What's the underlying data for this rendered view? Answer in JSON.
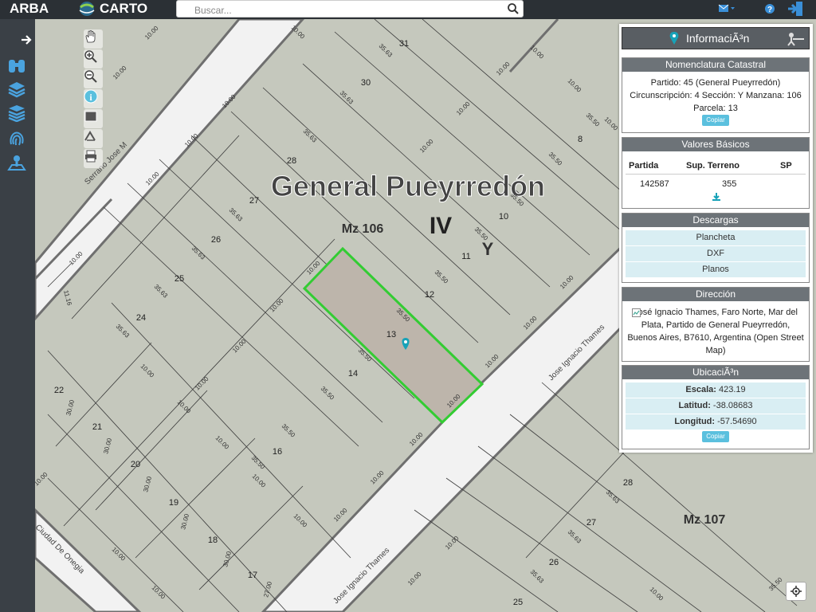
{
  "topbar": {
    "logo_arba": "ARBA",
    "logo_carto": "CARTO",
    "search_placeholder": "Buscar..."
  },
  "icons": {
    "left": [
      "arrow-right-icon",
      "binoculars-icon",
      "layers-icon",
      "layers-stack-icon",
      "fingerprint-icon",
      "map-pin-user-icon"
    ],
    "map_tools": [
      "pan-hand-icon",
      "zoom-in-icon",
      "zoom-out-icon",
      "info-icon",
      "select-box-icon",
      "measure-icon",
      "print-icon"
    ],
    "top_right": [
      "mail-icon",
      "help-icon",
      "logout-icon"
    ]
  },
  "colors": {
    "parcel_highlight": "#33cc33",
    "map_bg": "#c5c8bd",
    "street_fill": "#f2f2f2",
    "header_bg": "#2b3035",
    "panel_header": "#6d7378",
    "button_info": "#5bc0de"
  },
  "map": {
    "region_label": "General Pueyrredón",
    "circ_label": "IV",
    "section_label": "Y",
    "manzana_labels": [
      "Mz 106",
      "Mz 107"
    ],
    "selected_parcel": "13",
    "parcel_numbers": [
      "31",
      "30",
      "28",
      "27",
      "26",
      "25",
      "24",
      "22",
      "21",
      "20",
      "19",
      "18",
      "17",
      "16",
      "14",
      "13",
      "12",
      "11",
      "10",
      "8",
      "28",
      "27",
      "26",
      "25"
    ],
    "dimension_labels": [
      "10.00",
      "35.63",
      "35.50",
      "30.00",
      "11.16",
      "27.00"
    ],
    "street_labels": [
      "Serrano Jose M",
      "Jose Ignacio Thames",
      "Jose Ignacio Thames",
      "Ciudad De Onegia"
    ]
  },
  "panel": {
    "title": "InformaciÃ³n",
    "nomenclatura": {
      "header": "Nomenclatura Catastral",
      "line1": "Partido: 45 (General Pueyrredón)",
      "line2": "Circunscripción: 4 Sección: Y Manzana: 106",
      "line3": "Parcela: 13",
      "copy": "Copiar"
    },
    "valores": {
      "header": "Valores Básicos",
      "col1": "Partida",
      "col2": "Sup. Terreno",
      "col3": "SP",
      "partida": "142587",
      "sup": "355",
      "sp": ""
    },
    "descargas": {
      "header": "Descargas",
      "items": [
        "Plancheta",
        "DXF",
        "Planos"
      ]
    },
    "direccion": {
      "header": "Dirección",
      "text": "José Ignacio Thames, Faro Norte, Mar del Plata, Partido de General Pueyrredón, Buenos Aires, B7610, Argentina (Open Street Map)"
    },
    "ubicacion": {
      "header": "UbicaciÃ³n",
      "escala_label": "Escala:",
      "escala": "423.19",
      "latitud_label": "Latitud:",
      "latitud": "-38.08683",
      "longitud_label": "Longitud:",
      "longitud": "-57.54690",
      "copy": "Copiar"
    }
  }
}
